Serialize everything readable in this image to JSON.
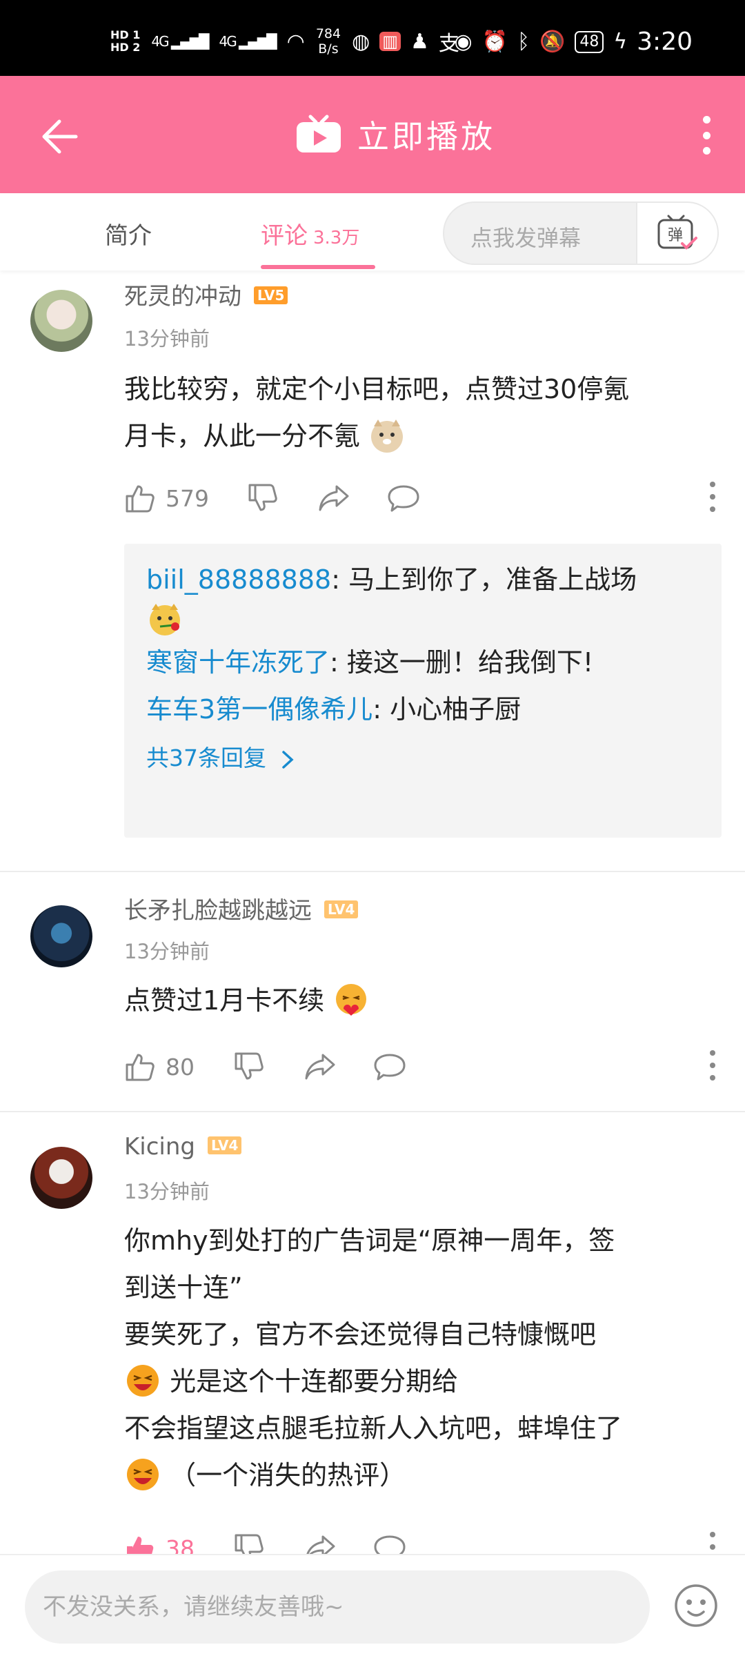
{
  "status_bar": {
    "hd1": "HD 1",
    "hd2": "HD 2",
    "net1": "4G",
    "net2": "4G",
    "speed_value": "784",
    "speed_unit": "B/s",
    "battery": "48",
    "time": "3:20"
  },
  "header": {
    "title": "立即播放"
  },
  "tabs": {
    "intro": "简介",
    "comments": "评论",
    "comments_count": "3.3万",
    "danmu_placeholder": "点我发弹幕",
    "danmu_button_glyph": "弹"
  },
  "comments": [
    {
      "username": "死灵的冲动",
      "level": "LV5",
      "time": "13分钟前",
      "text_line1": "我比较穷，就定个小目标吧，点赞过30停氪",
      "text_line2": "月卡，从此一分不氪",
      "likes": "579",
      "replies": [
        {
          "user": "biil_88888888",
          "text": ": 马上到你了，准备上战场"
        },
        {
          "user": "寒窗十年冻死了",
          "text": ": 接这一删！给我倒下!"
        },
        {
          "user": "车车3第一偶像希儿",
          "text": ": 小心柚子厨"
        }
      ],
      "reply_more": "共37条回复"
    },
    {
      "username": "长矛扎脸越跳越远",
      "level": "LV4",
      "time": "13分钟前",
      "text_line1": "点赞过1月卡不续",
      "likes": "80"
    },
    {
      "username": "Kicing",
      "level": "LV4",
      "time": "13分钟前",
      "text_line1": "你mhy到处打的广告词是“原神一周年，签",
      "text_line2": "到送十连”",
      "text_line3": "要笑死了，官方不会还觉得自己特慷慨吧",
      "text_line4": "光是这个十连都要分期给",
      "text_line5": "不会指望这点腿毛拉新人入坑吧，蚌埠住了",
      "text_line6": "（一个消失的热评）",
      "likes": "38"
    }
  ],
  "input": {
    "placeholder": "不发没关系，请继续友善哦~"
  },
  "colors": {
    "brand_pink": "#fb7299",
    "link_blue": "#178bcf",
    "status_bar": "#000000"
  }
}
